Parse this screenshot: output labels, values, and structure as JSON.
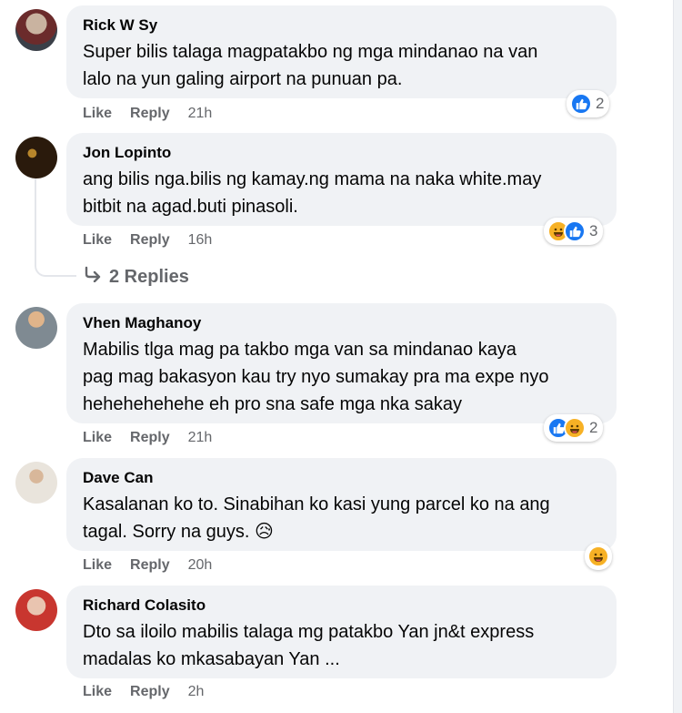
{
  "actions": {
    "like": "Like",
    "reply": "Reply"
  },
  "comments": [
    {
      "author": "Rick W Sy",
      "text": "Super bilis talaga magpatakbo ng mga mindanao na van\nlalo na yun galing airport na punuan pa.",
      "time": "21h",
      "reactions": [
        "like"
      ],
      "count": "2"
    },
    {
      "author": "Jon Lopinto",
      "text": "ang bilis nga.bilis ng kamay.ng mama na naka white.may\nbitbit na agad.buti pinasoli.",
      "time": "16h",
      "reactions": [
        "haha",
        "like"
      ],
      "count": "3",
      "replies": "2 Replies"
    },
    {
      "author": "Vhen Maghanoy",
      "text": "Mabilis tlga mag pa takbo mga van sa mindanao kaya\npag mag bakasyon kau try nyo sumakay pra ma expe nyo\nhehehehehehe eh pro sna safe mga nka sakay",
      "time": "21h",
      "reactions": [
        "like",
        "haha"
      ],
      "count": "2"
    },
    {
      "author": "Dave Can",
      "text": "Kasalanan ko to. Sinabihan ko kasi yung parcel ko na ang\ntagal. Sorry na guys.",
      "emoji": "😥",
      "time": "20h",
      "reactions": [
        "haha"
      ],
      "count": ""
    },
    {
      "author": "Richard Colasito",
      "text": "Dto sa iloilo mabilis talaga mg patakbo Yan jn&t express\nmadalas ko mkasabayan Yan ...",
      "time": "2h",
      "reactions": [],
      "count": ""
    }
  ],
  "icon_names": [
    "like-icon",
    "haha-icon",
    "reply-arrow-icon",
    "avatar"
  ]
}
